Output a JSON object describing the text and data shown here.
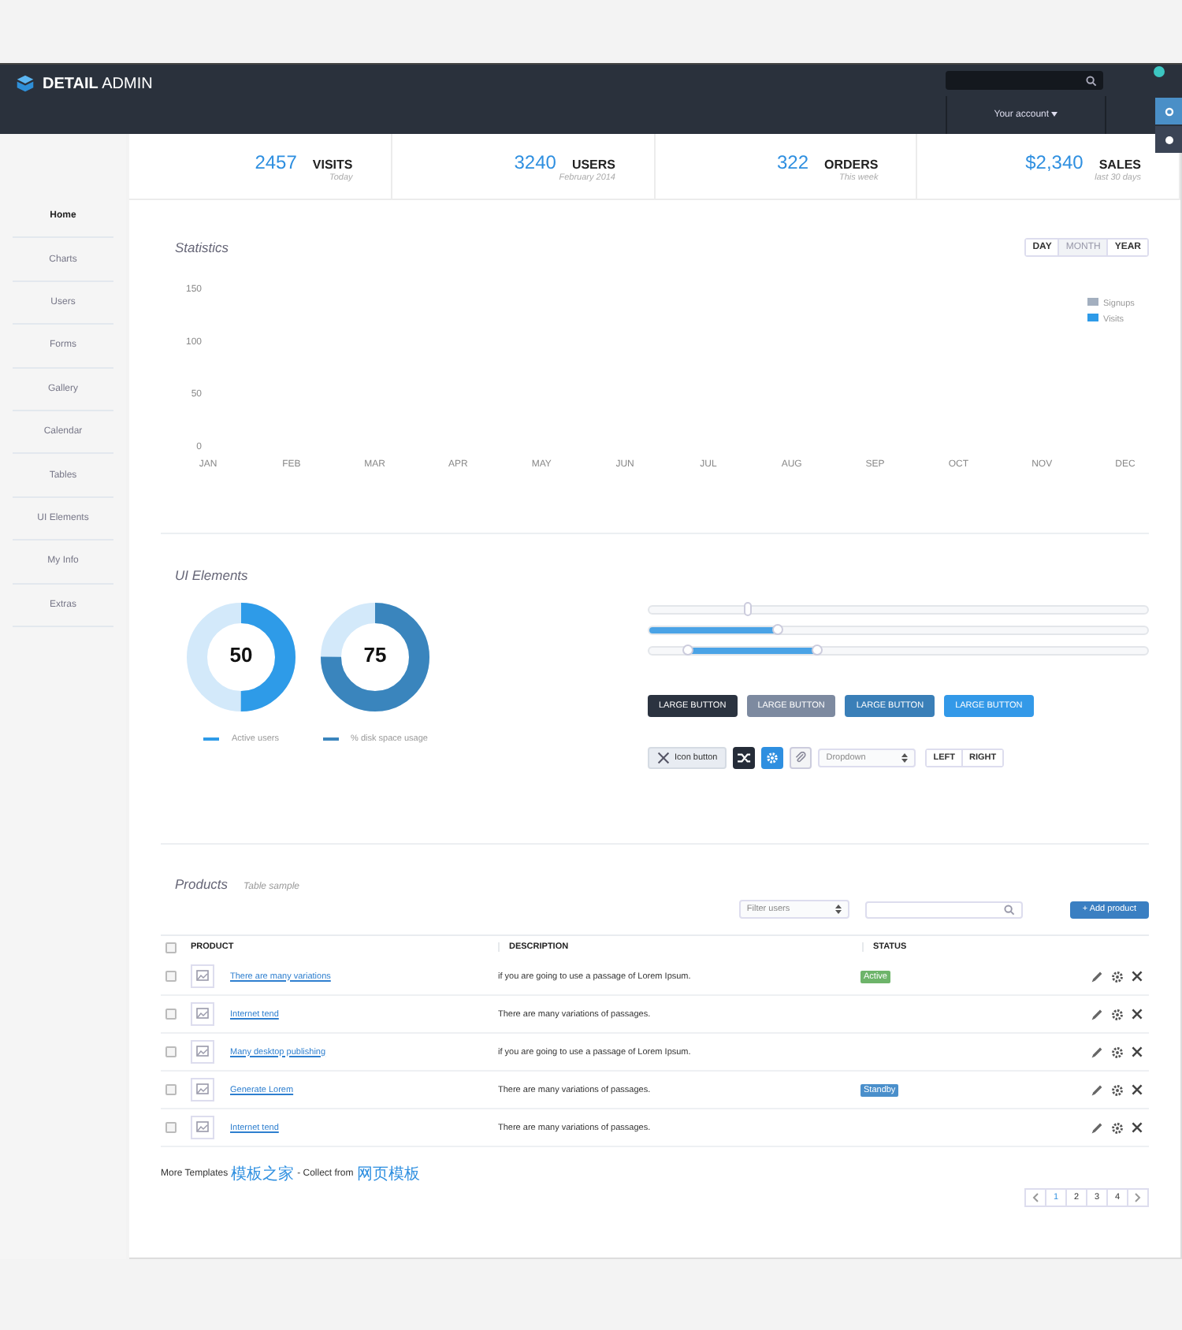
{
  "header": {
    "logo": "**DETAIL** ADMIN",
    "account": "Your account"
  },
  "sidebar": {
    "items": [
      {
        "label": "Home",
        "selected": true
      },
      {
        "label": "Charts",
        "selected": false
      },
      {
        "label": "Users",
        "selected": false
      },
      {
        "label": "Forms",
        "selected": false
      },
      {
        "label": "Gallery",
        "selected": false
      },
      {
        "label": "Calendar",
        "selected": false
      },
      {
        "label": "Tables",
        "selected": false
      },
      {
        "label": "UI Elements",
        "selected": false
      },
      {
        "label": "My Info",
        "selected": false
      },
      {
        "label": "Extras",
        "selected": false
      }
    ]
  },
  "stats": [
    {
      "value": "2457",
      "label": "VISITS",
      "caption": "Today"
    },
    {
      "value": "3240",
      "label": "USERS",
      "caption": "February 2014"
    },
    {
      "value": "322",
      "label": "ORDERS",
      "caption": "This week"
    },
    {
      "value": "$2,340",
      "label": "SALES",
      "caption": "last 30 days"
    }
  ],
  "statistics": {
    "title": "Statistics",
    "periods": [
      {
        "label": "DAY",
        "selected": false
      },
      {
        "label": "MONTH",
        "selected": true
      },
      {
        "label": "YEAR",
        "selected": false
      }
    ],
    "chart_data": {
      "type": "line",
      "categories": [
        "JAN",
        "FEB",
        "MAR",
        "APR",
        "MAY",
        "JUN",
        "JUL",
        "AUG",
        "SEP",
        "OCT",
        "NOV",
        "DEC"
      ],
      "yticks": [
        0,
        50,
        100,
        150
      ],
      "ylim": [
        0,
        150
      ],
      "series": [
        {
          "name": "Signups",
          "color": "#a3afbf",
          "values": [
            null,
            null,
            null,
            null,
            null,
            null,
            null,
            null,
            null,
            null,
            null,
            null
          ]
        },
        {
          "name": "Visits",
          "color": "#2e9be8",
          "values": [
            null,
            null,
            null,
            null,
            null,
            null,
            null,
            null,
            null,
            null,
            null,
            null
          ]
        }
      ]
    }
  },
  "ui_elements": {
    "title": "UI Elements",
    "gauges": [
      {
        "value": "50",
        "level": 0.5,
        "legend": "Active users",
        "color": "#2e9be8"
      },
      {
        "value": "75",
        "level": 0.75,
        "legend": "% disk space usage",
        "color": "#3a85bd"
      }
    ],
    "sliders": [
      {
        "kind": "plain",
        "thumbs": [
          {
            "level": 0.2
          }
        ]
      },
      {
        "kind": "fill",
        "thumbs": [
          {
            "level": 0.26
          }
        ]
      },
      {
        "kind": "range",
        "thumbs": [
          {
            "level": 0.08
          },
          {
            "level": 0.34
          }
        ]
      }
    ],
    "large_buttons": [
      {
        "label": "LARGE BUTTON",
        "color": "#2b3340"
      },
      {
        "label": "LARGE BUTTON",
        "color": "#7d8aa0"
      },
      {
        "label": "LARGE BUTTON",
        "color": "#3a7fb8"
      },
      {
        "label": "LARGE BUTTON",
        "color": "#3399e8"
      }
    ],
    "icon_button": "Icon button",
    "dropdown": "Dropdown",
    "segments": [
      {
        "label": "LEFT"
      },
      {
        "label": "RIGHT"
      }
    ]
  },
  "products": {
    "title": "Products",
    "subtitle": "Table sample",
    "filter": "Filter users",
    "add_button": "+ Add product",
    "all_checked": false,
    "columns": [
      "PRODUCT",
      "DESCRIPTION",
      "STATUS"
    ],
    "rows": [
      {
        "checked": false,
        "product": "There are many variations",
        "description": "if you are going to use a passage of Lorem Ipsum.",
        "status": "Active",
        "color": "#6db46a"
      },
      {
        "checked": false,
        "product": "Internet tend",
        "description": "There are many variations of passages."
      },
      {
        "checked": false,
        "product": "Many desktop publishing",
        "description": "if you are going to use a passage of Lorem Ipsum."
      },
      {
        "checked": false,
        "product": "Generate Lorem",
        "description": "There are many variations of passages.",
        "status": "Standby",
        "color": "#4a8fcb"
      },
      {
        "checked": false,
        "product": "Internet tend",
        "description": "There are many variations of passages."
      }
    ],
    "footer": {
      "text": "More Templates",
      "link1": "模板之家",
      "middle": "- Collect from",
      "link2": "网页模板"
    },
    "pages": [
      {
        "label": "1",
        "selected": true
      },
      {
        "label": "2",
        "selected": false
      },
      {
        "label": "3",
        "selected": false
      },
      {
        "label": "4",
        "selected": false
      }
    ]
  }
}
